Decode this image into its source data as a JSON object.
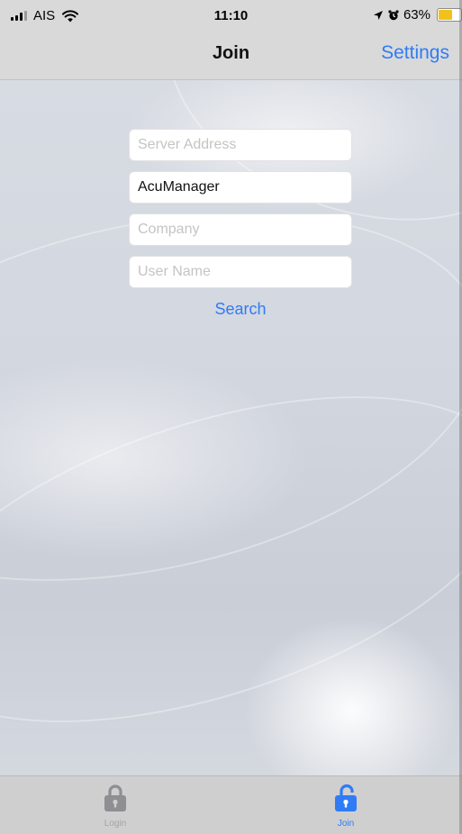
{
  "status_bar": {
    "carrier": "AIS",
    "time": "11:10",
    "battery_percent": "63%",
    "battery_level": 0.63
  },
  "nav": {
    "title": "Join",
    "settings_label": "Settings"
  },
  "form": {
    "server_address": {
      "value": "",
      "placeholder": "Server Address"
    },
    "app_name": {
      "value": "AcuManager",
      "placeholder": ""
    },
    "company": {
      "value": "",
      "placeholder": "Company"
    },
    "user_name": {
      "value": "",
      "placeholder": "User Name"
    },
    "search_label": "Search"
  },
  "tabs": [
    {
      "label": "Login",
      "icon": "lock-closed-icon",
      "active": false
    },
    {
      "label": "Join",
      "icon": "lock-open-icon",
      "active": true
    }
  ],
  "colors": {
    "accent": "#2f7cf6",
    "inactive_tab": "#8e8e93",
    "battery": "#f2c21b"
  }
}
